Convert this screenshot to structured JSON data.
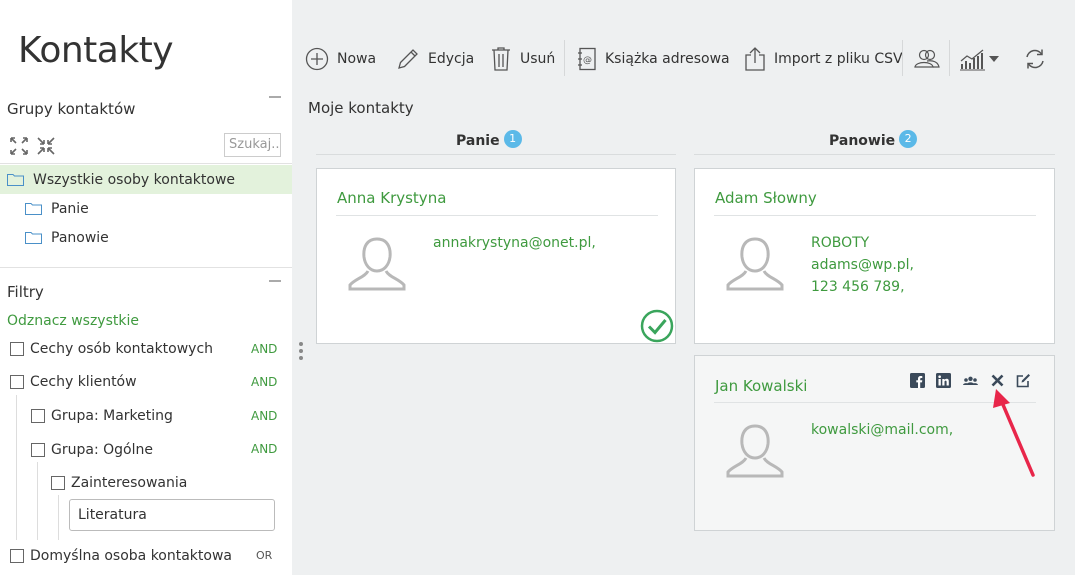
{
  "app": {
    "title": "Kontakty"
  },
  "groups": {
    "heading": "Grupy kontaktów",
    "search_placeholder": "Szukaj...",
    "items": [
      {
        "label": "Wszystkie osoby kontaktowe",
        "active": true
      },
      {
        "label": "Panie"
      },
      {
        "label": "Panowie"
      }
    ]
  },
  "filters": {
    "heading": "Filtry",
    "select_all": "Odznacz wszystkie",
    "items": [
      {
        "label": "Cechy osób kontaktowych",
        "logic": "AND"
      },
      {
        "label": "Cechy klientów",
        "logic": "AND"
      },
      {
        "label": "Grupa: Marketing",
        "logic": "AND"
      },
      {
        "label": "Grupa: Ogólne",
        "logic": "AND"
      },
      {
        "label": "Zainteresowania",
        "logic": ""
      },
      {
        "label": "Domyślna osoba kontaktowa",
        "logic": "OR"
      }
    ],
    "interest_value": "Literatura"
  },
  "toolbar": {
    "new": "Nowa",
    "edit": "Edycja",
    "delete": "Usuń",
    "address_book": "Książka adresowa",
    "import": "Import z pliku CSV"
  },
  "main": {
    "title": "Moje kontakty",
    "columns": [
      {
        "label": "Panie",
        "count": "1"
      },
      {
        "label": "Panowie",
        "count": "2"
      }
    ]
  },
  "cards": [
    {
      "name": "Anna Krystyna",
      "lines": [
        "annakrystyna@onet.pl,"
      ],
      "selected": true
    },
    {
      "name": "Adam Słowny",
      "lines": [
        "ROBOTY",
        "adams@wp.pl,",
        "123 456 789,"
      ]
    },
    {
      "name": "Jan Kowalski",
      "lines": [
        "kowalski@mail.com,"
      ]
    }
  ],
  "colors": {
    "accent_green": "#3f9a3f",
    "badge_blue": "#5bb9e8",
    "arrow_red": "#e8264a"
  }
}
